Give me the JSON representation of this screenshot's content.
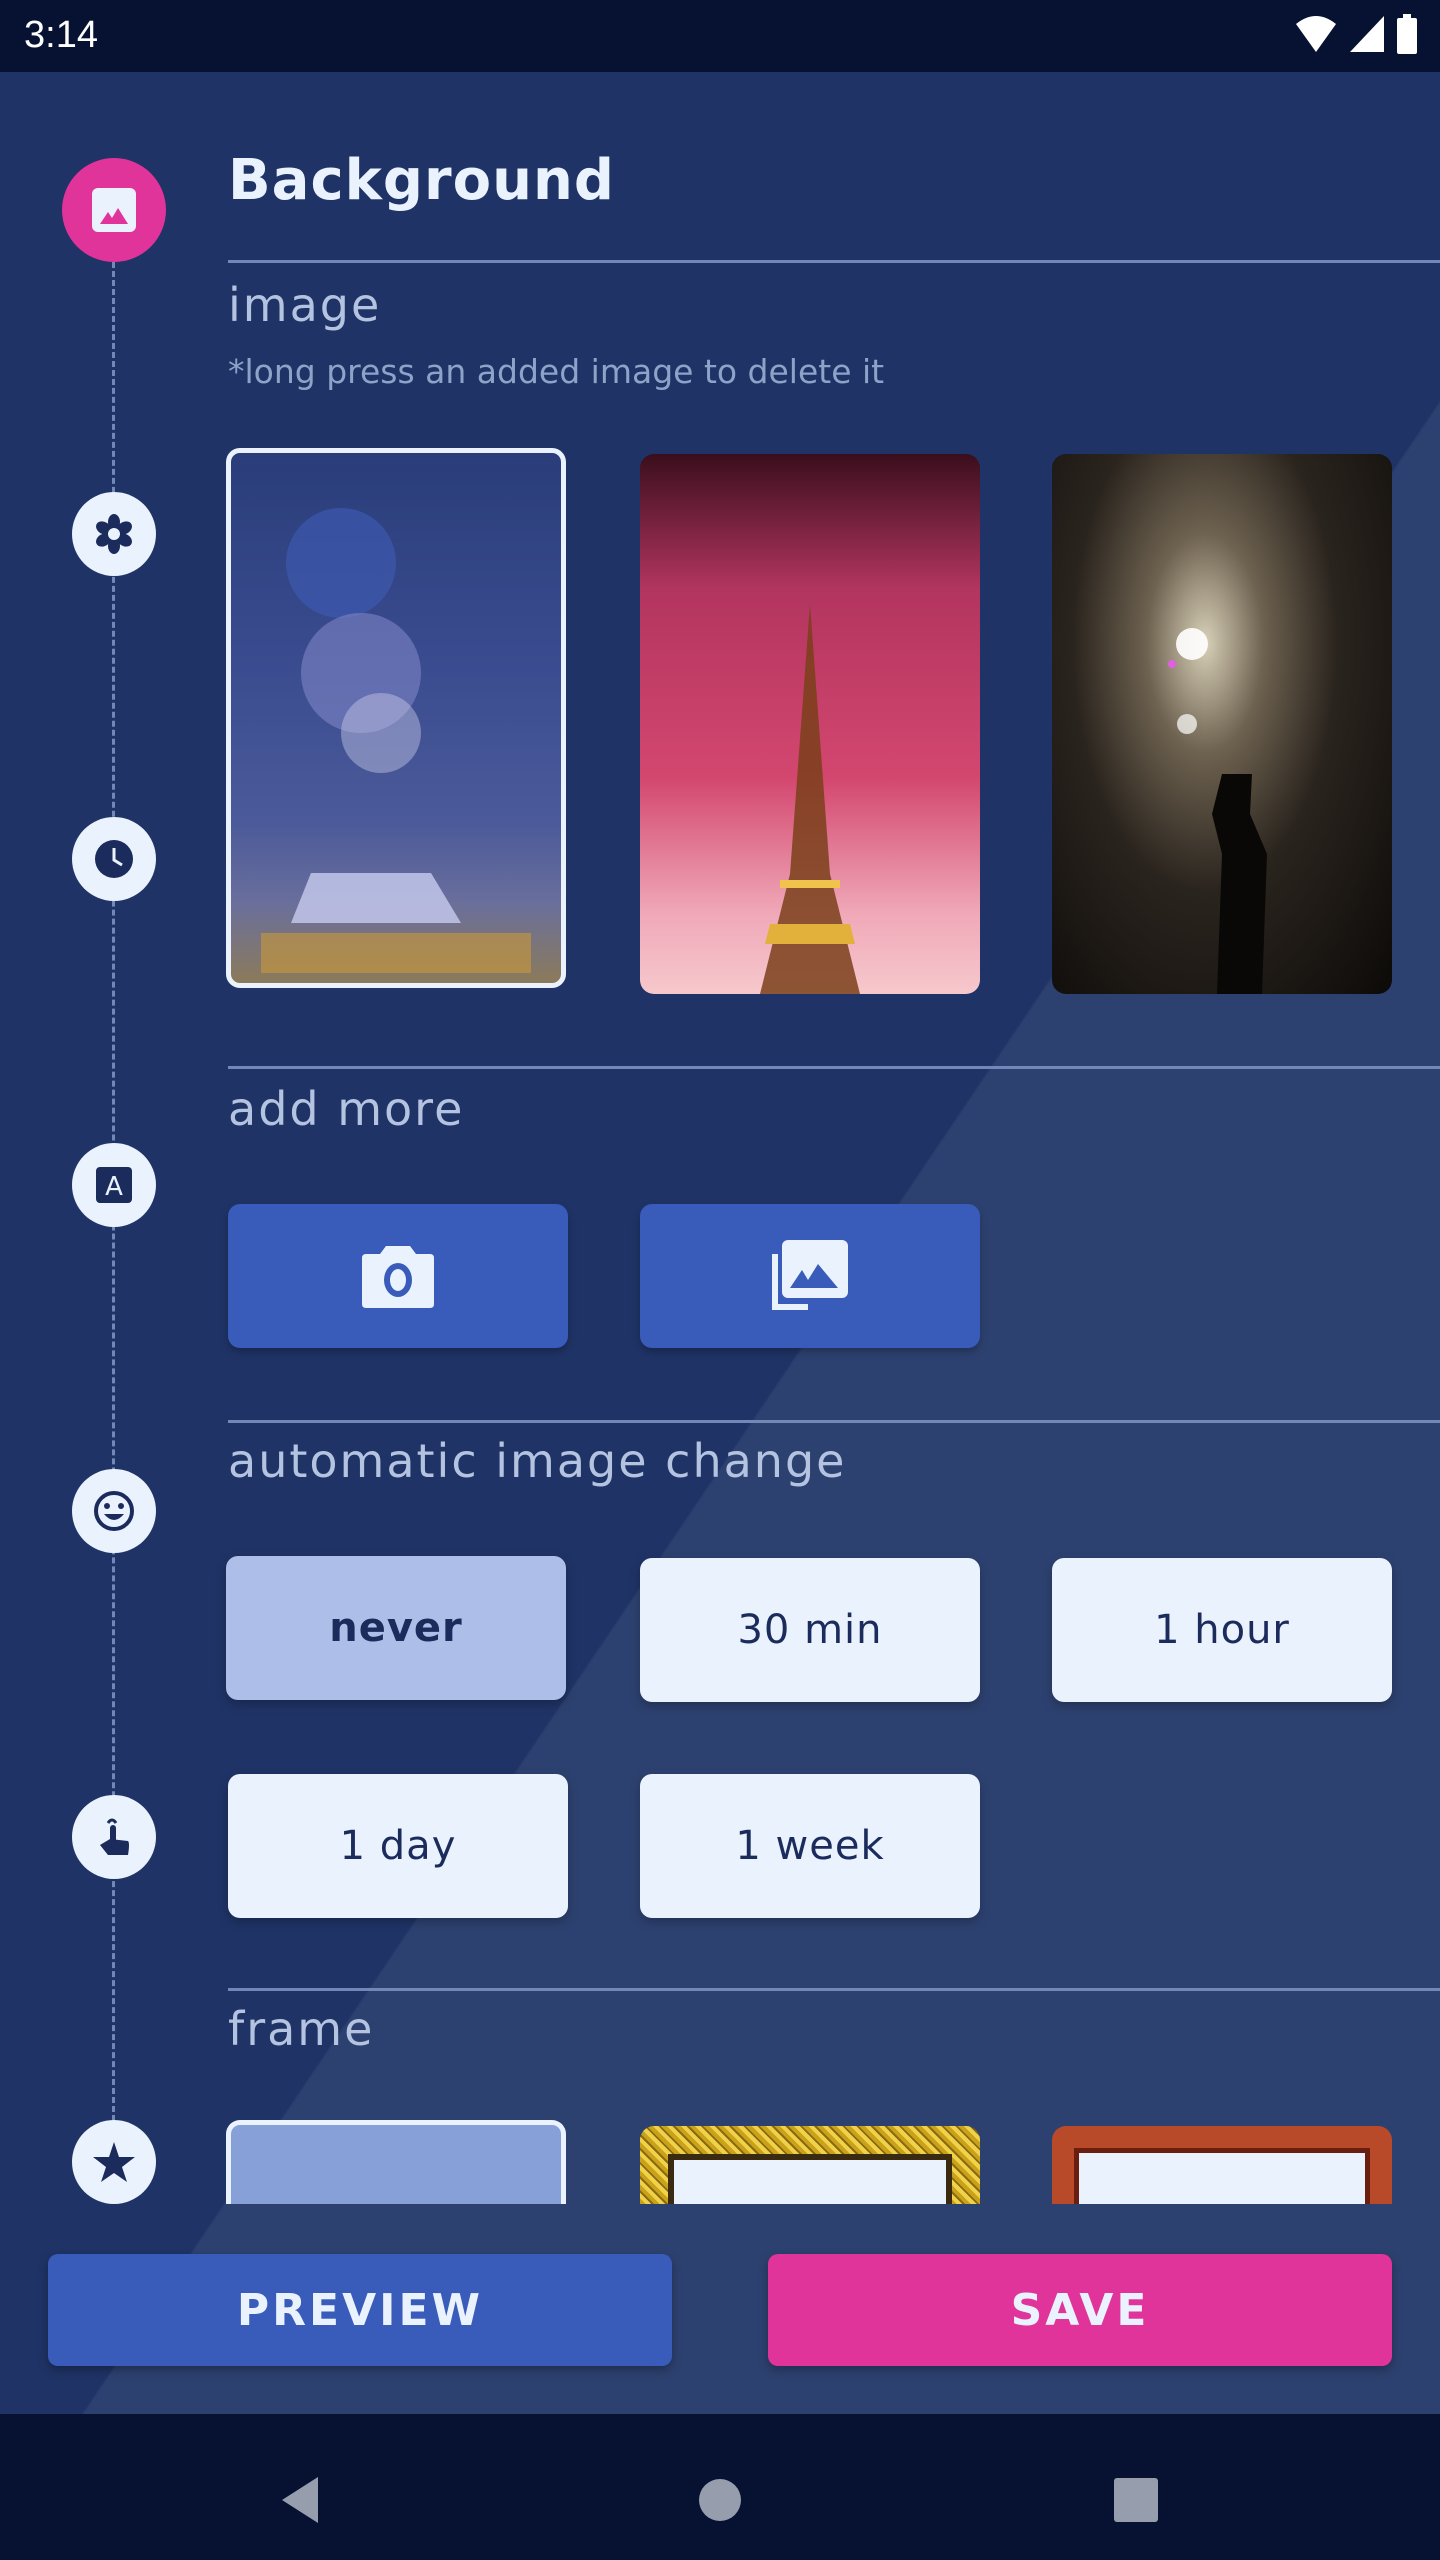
{
  "status_bar": {
    "time": "3:14",
    "icons": [
      "wifi-icon",
      "cellular-signal-icon",
      "battery-icon"
    ]
  },
  "header": {
    "title": "Background",
    "icon": "image-icon"
  },
  "timeline": {
    "items": [
      {
        "icon": "image-icon",
        "active": true
      },
      {
        "icon": "flower-icon",
        "active": false
      },
      {
        "icon": "clock-icon",
        "active": false
      },
      {
        "icon": "text-font-icon",
        "active": false
      },
      {
        "icon": "smiley-icon",
        "active": false
      },
      {
        "icon": "touch-icon",
        "active": false
      },
      {
        "icon": "star-icon",
        "active": false
      }
    ]
  },
  "image_section": {
    "title": "image",
    "hint": "*long press an added image to delete it",
    "thumbnails": [
      {
        "name": "fireworks over castle",
        "selected": true
      },
      {
        "name": "fireworks at eiffel tower",
        "selected": false
      },
      {
        "name": "fireworks with silhouette",
        "selected": false
      }
    ]
  },
  "add_more_section": {
    "title": "add more",
    "buttons": [
      {
        "icon": "camera-icon",
        "action": "take photo"
      },
      {
        "icon": "photo-library-icon",
        "action": "choose from gallery"
      }
    ]
  },
  "auto_change_section": {
    "title": "automatic image change",
    "options": [
      {
        "label": "never",
        "selected": true
      },
      {
        "label": "30 min",
        "selected": false
      },
      {
        "label": "1 hour",
        "selected": false
      },
      {
        "label": "1 day",
        "selected": false
      },
      {
        "label": "1 week",
        "selected": false
      }
    ]
  },
  "frame_section": {
    "title": "frame",
    "frames": [
      {
        "name": "no frame",
        "selected": true
      },
      {
        "name": "gold glitter frame",
        "selected": false
      },
      {
        "name": "wooden frame",
        "selected": false
      }
    ]
  },
  "actions": {
    "preview_label": "PREVIEW",
    "save_label": "SAVE"
  },
  "colors": {
    "background": "#1f3366",
    "accent_pink": "#e0349a",
    "accent_blue": "#395cbb",
    "selected_option": "#adbfe8",
    "light": "#e9f2fd"
  },
  "navigation": {
    "buttons": [
      "back-icon",
      "home-icon",
      "recents-icon"
    ]
  }
}
